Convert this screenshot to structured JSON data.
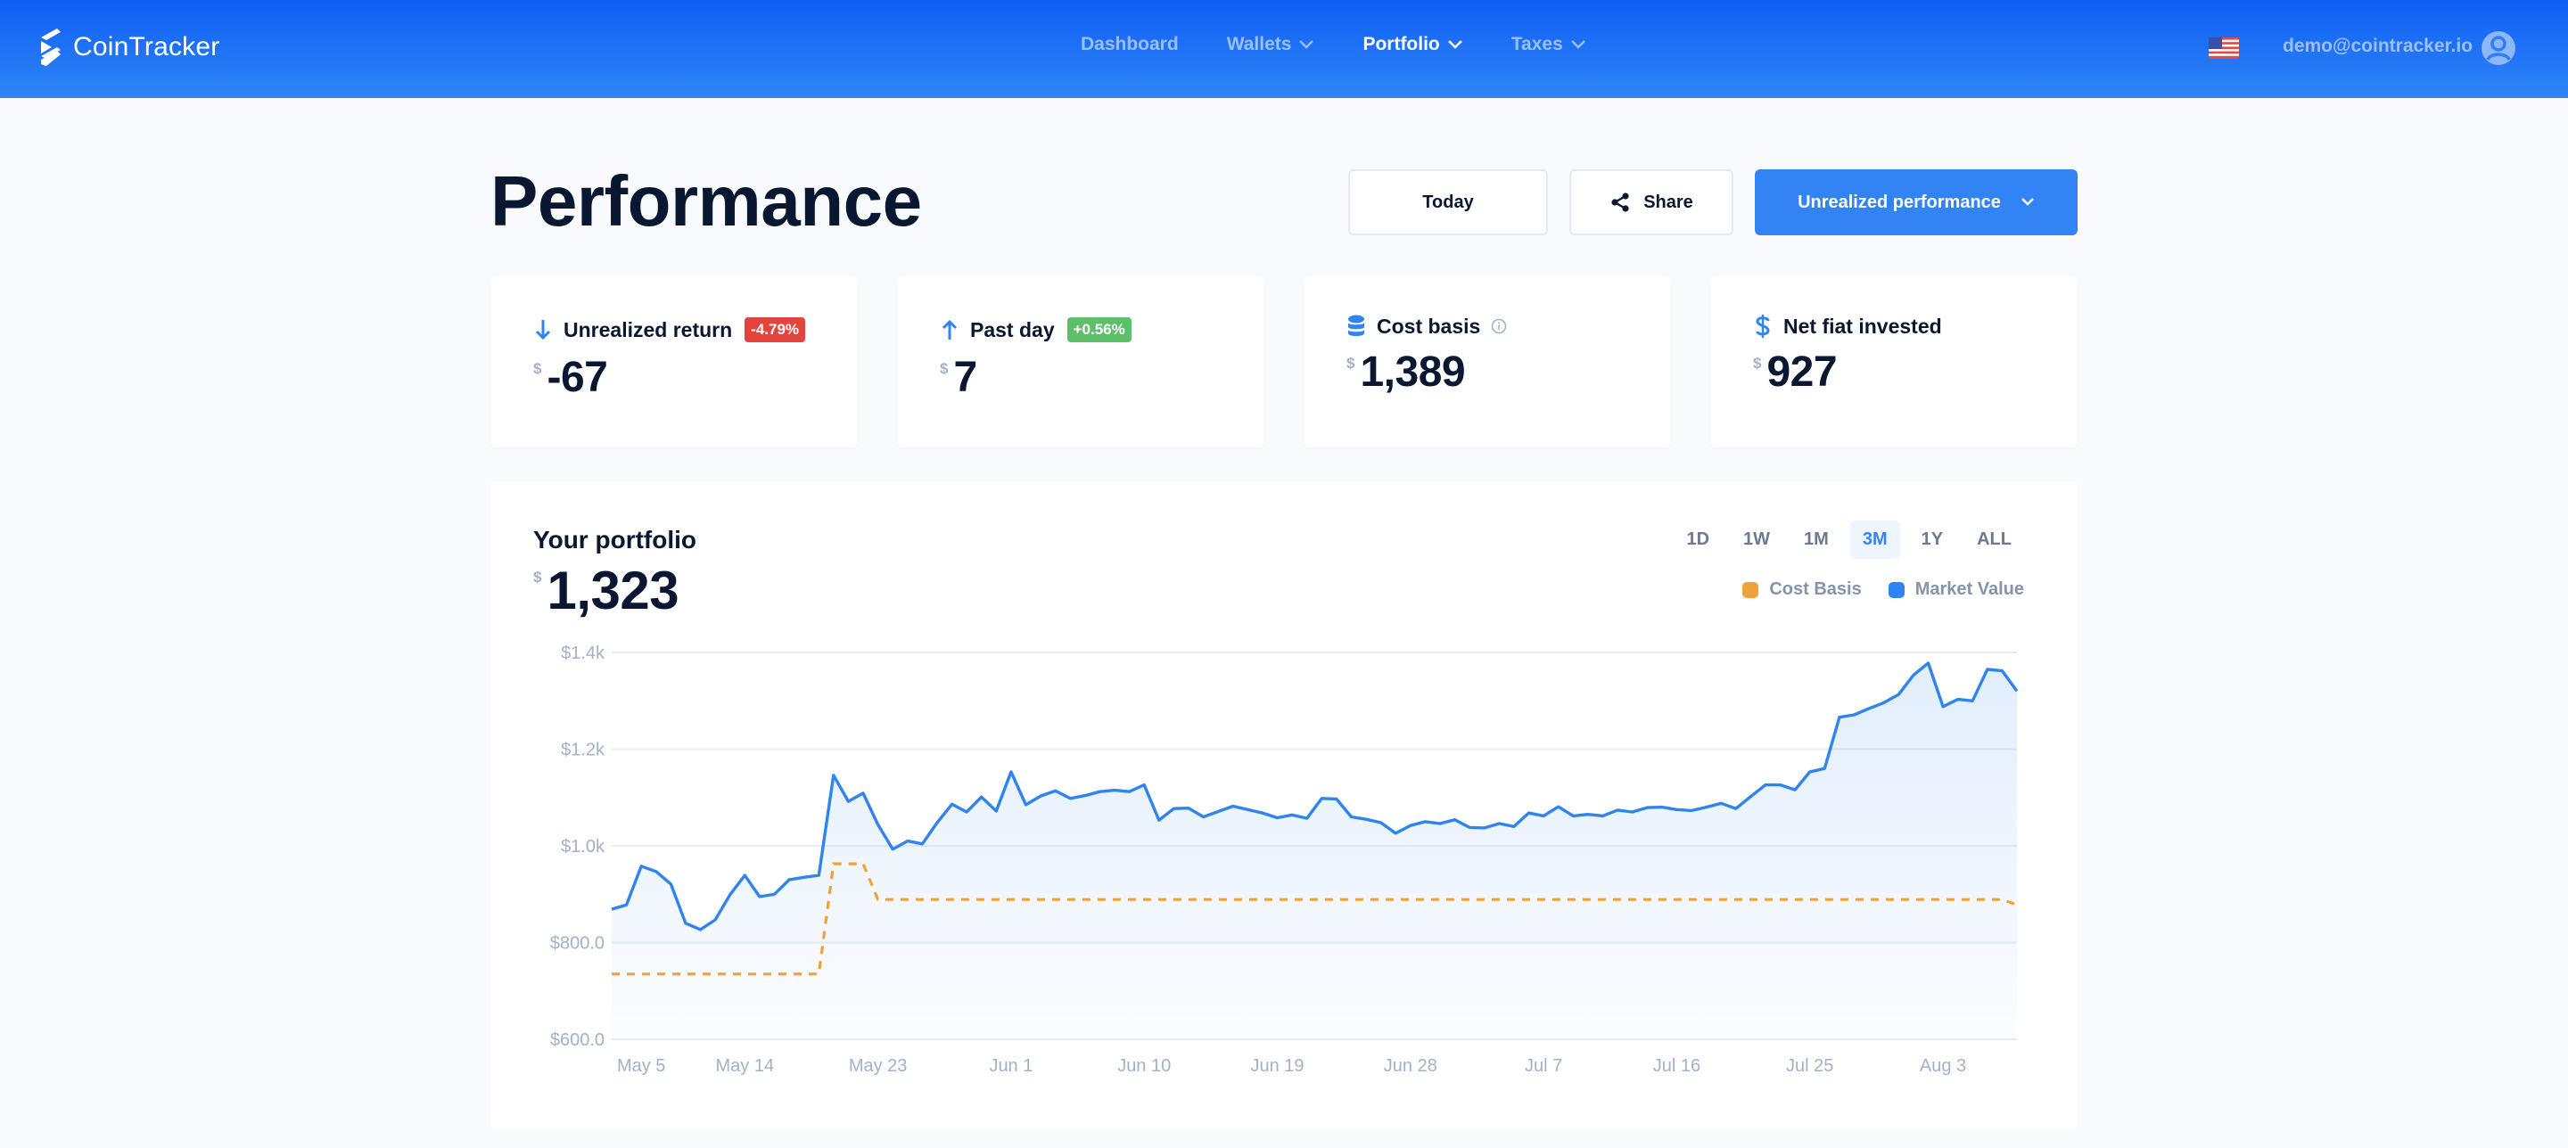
{
  "app": {
    "name": "CoinTracker"
  },
  "nav": {
    "links": [
      {
        "label": "Dashboard",
        "has_dropdown": false,
        "active": false
      },
      {
        "label": "Wallets",
        "has_dropdown": true,
        "active": false
      },
      {
        "label": "Portfolio",
        "has_dropdown": true,
        "active": true
      },
      {
        "label": "Taxes",
        "has_dropdown": true,
        "active": false
      }
    ],
    "locale_flag": "us-flag-icon",
    "user_email": "demo@cointracker.io",
    "avatar_icon": "user-circle-icon"
  },
  "header": {
    "title": "Performance",
    "date_button": "Today",
    "share_button": "Share",
    "mode_dropdown": "Unrealized performance"
  },
  "stats": [
    {
      "label": "Unrealized return",
      "icon": "arrow-down-icon",
      "badge": "-4.79%",
      "badge_type": "negative",
      "currency": "$",
      "value": "-67"
    },
    {
      "label": "Past day",
      "icon": "arrow-up-icon",
      "badge": "+0.56%",
      "badge_type": "positive",
      "currency": "$",
      "value": "7"
    },
    {
      "label": "Cost basis",
      "icon": "database-icon",
      "info": true,
      "currency": "$",
      "value": "1,389"
    },
    {
      "label": "Net fiat invested",
      "icon": "dollar-icon",
      "currency": "$",
      "value": "927"
    }
  ],
  "portfolio": {
    "title": "Your portfolio",
    "currency": "$",
    "value": "1,323",
    "ranges": [
      "1D",
      "1W",
      "1M",
      "3M",
      "1Y",
      "ALL"
    ],
    "active_range": "3M"
  },
  "colors": {
    "accent": "#3284f5",
    "market_value": "#2f84f0",
    "cost_basis": "#f0a23a",
    "negative": "#e3443d",
    "positive": "#5dbf6a"
  },
  "chart_data": {
    "type": "line",
    "title": "Your portfolio",
    "xlabel": "",
    "ylabel": "",
    "ylim": [
      600,
      1400
    ],
    "yticks": [
      600,
      800,
      1000,
      1200,
      1400
    ],
    "ytick_labels": [
      "$600.0",
      "$800.0",
      "$1.0k",
      "$1.2k",
      "$1.4k"
    ],
    "xtick_labels": [
      "May 5",
      "May 14",
      "May 23",
      "Jun 1",
      "Jun 10",
      "Jun 19",
      "Jun 28",
      "Jul 7",
      "Jul 16",
      "Jul 25",
      "Aug 3"
    ],
    "xtick_index": [
      2,
      9,
      18,
      27,
      36,
      45,
      54,
      63,
      72,
      81,
      90
    ],
    "grid": true,
    "legend": "top-right",
    "series": [
      {
        "name": "Market Value",
        "style": "solid-area",
        "values": [
          869,
          878,
          958,
          947,
          921,
          840,
          827,
          847,
          899,
          939,
          895,
          900,
          930,
          935,
          939,
          1146,
          1092,
          1109,
          1044,
          993,
          1010,
          1004,
          1048,
          1086,
          1070,
          1101,
          1072,
          1153,
          1085,
          1103,
          1114,
          1098,
          1104,
          1112,
          1115,
          1112,
          1126,
          1053,
          1077,
          1078,
          1060,
          1071,
          1082,
          1075,
          1068,
          1058,
          1064,
          1057,
          1098,
          1097,
          1060,
          1055,
          1048,
          1026,
          1042,
          1050,
          1046,
          1054,
          1038,
          1037,
          1046,
          1040,
          1068,
          1062,
          1081,
          1062,
          1065,
          1062,
          1074,
          1070,
          1079,
          1080,
          1075,
          1073,
          1080,
          1088,
          1077,
          1102,
          1126,
          1126,
          1116,
          1153,
          1160,
          1266,
          1271,
          1284,
          1296,
          1313,
          1353,
          1378,
          1288,
          1303,
          1300,
          1365,
          1362,
          1320
        ]
      },
      {
        "name": "Cost Basis",
        "style": "dashed",
        "values": [
          735,
          735,
          735,
          735,
          735,
          735,
          735,
          735,
          735,
          735,
          735,
          735,
          735,
          735,
          735,
          963,
          963,
          963,
          889,
          889,
          889,
          889,
          889,
          889,
          889,
          889,
          889,
          889,
          889,
          889,
          889,
          889,
          889,
          889,
          889,
          889,
          889,
          889,
          889,
          889,
          889,
          889,
          889,
          889,
          889,
          889,
          889,
          889,
          889,
          889,
          889,
          889,
          889,
          889,
          889,
          889,
          889,
          889,
          889,
          889,
          889,
          889,
          889,
          889,
          889,
          889,
          889,
          889,
          889,
          889,
          889,
          889,
          889,
          889,
          889,
          889,
          889,
          889,
          889,
          889,
          889,
          889,
          889,
          889,
          889,
          889,
          889,
          889,
          889,
          889,
          889,
          889,
          889,
          889,
          889,
          878
        ]
      }
    ]
  }
}
